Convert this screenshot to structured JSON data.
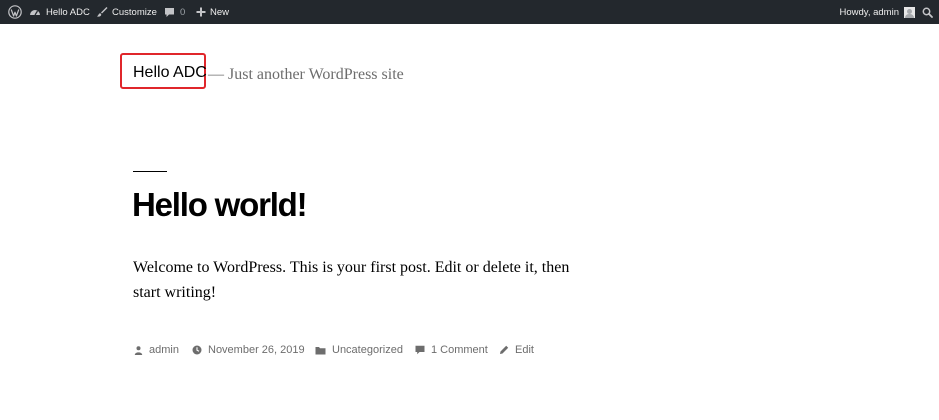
{
  "admin_bar": {
    "site_name": "Hello ADC",
    "customize_label": "Customize",
    "comment_count": "0",
    "new_label": "New",
    "howdy_text": "Howdy, admin",
    "icons": {
      "wp": "wordpress-logo-icon",
      "site": "dashboard-icon",
      "customize": "paintbrush-icon",
      "comments": "comment-bubble-icon",
      "new": "plus-icon",
      "avatar": "avatar-icon",
      "search": "search-icon"
    }
  },
  "header": {
    "site_title": "Hello ADC",
    "tagline": "— Just another WordPress site"
  },
  "post": {
    "title": "Hello world!",
    "content": "Welcome to WordPress. This is your first post. Edit or delete it, then start writing!",
    "meta": {
      "author": "admin",
      "date": "November 26, 2019",
      "category": "Uncategorized",
      "comments": "1 Comment",
      "edit": "Edit"
    }
  },
  "colors": {
    "admin_bar_bg": "#23282d",
    "highlight_border": "#e0262b",
    "meta_text": "#6d6d6d"
  }
}
